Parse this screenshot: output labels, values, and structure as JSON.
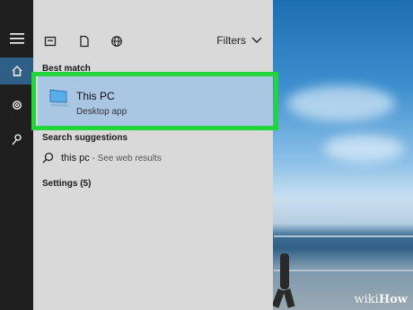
{
  "colors": {
    "panel_bg": "#d9d9d9",
    "leftbar_bg": "#1f1f1f",
    "selected_result": "#a9c6e3",
    "highlight_border": "#22d53a"
  },
  "leftbar": {
    "items": [
      {
        "icon": "hamburger-menu-icon"
      },
      {
        "icon": "home-icon"
      },
      {
        "icon": "settings-gear-icon"
      },
      {
        "icon": "feedback-icon"
      }
    ]
  },
  "panel": {
    "top_icons": [
      "apps-icon",
      "documents-icon",
      "web-globe-icon"
    ],
    "filters_label": "Filters",
    "best_match_label": "Best match",
    "best_match": {
      "title": "This PC",
      "subtitle": "Desktop app",
      "icon": "monitor-icon"
    },
    "search_suggestions_label": "Search suggestions",
    "suggestion": {
      "query": "this pc",
      "suffix": " - See web results"
    },
    "settings_label": "Settings (5)"
  },
  "watermark": {
    "prefix": "wiki",
    "suffix": "How"
  }
}
